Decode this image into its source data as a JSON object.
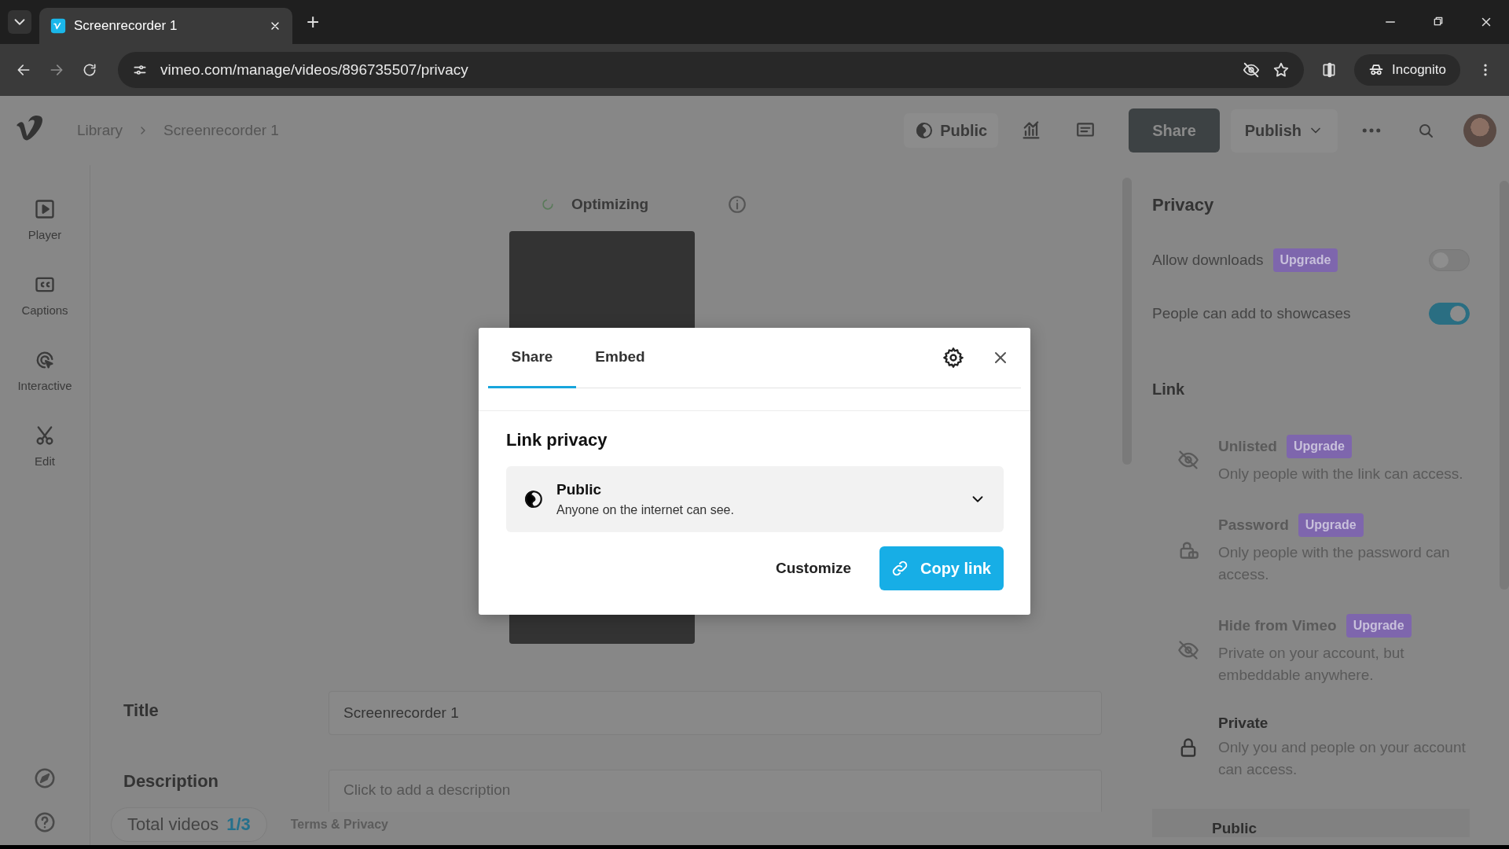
{
  "browser": {
    "tabs": [
      {
        "title": "Screenrecorder 1",
        "selected": true
      }
    ],
    "new_tab": "+",
    "address": "vimeo.com/manage/videos/896735507/privacy",
    "profile": "Incognito"
  },
  "header": {
    "breadcrumb": [
      "Library",
      "Screenrecorder 1"
    ],
    "privacy": "Public",
    "share": "Share",
    "publish": "Publish"
  },
  "sidebar": {
    "items": [
      {
        "label": "Player"
      },
      {
        "label": "Captions"
      },
      {
        "label": "Interactive"
      },
      {
        "label": "Edit"
      }
    ]
  },
  "main": {
    "status": "Optimizing",
    "fields": [
      {
        "label": "Title",
        "value": "Screenrecorder 1"
      },
      {
        "label": "Description",
        "placeholder": "Click to add a description"
      }
    ],
    "total_label": "Total videos",
    "total_count": "1/3",
    "terms": "Terms & Privacy"
  },
  "privacy_panel": {
    "title": "Privacy",
    "settings": [
      {
        "label": "Allow downloads",
        "badge": "Upgrade",
        "on": false
      },
      {
        "label": "People can add to showcases",
        "on": true
      }
    ],
    "link_heading": "Link",
    "options": [
      {
        "title": "Unlisted",
        "badge": "Upgrade",
        "description": "Only people with the link can access.",
        "disabled": true
      },
      {
        "title": "Password",
        "badge": "Upgrade",
        "description": "Only people with the password can access.",
        "disabled": true
      },
      {
        "title": "Hide from Vimeo",
        "badge": "Upgrade",
        "description": "Private on your account, but embeddable anywhere.",
        "disabled": true
      },
      {
        "title": "Private",
        "description": "Only you and people on your account can access.",
        "disabled": false
      },
      {
        "title": "Public",
        "disabled": false
      }
    ]
  },
  "modal": {
    "tabs": [
      {
        "label": "Share",
        "selected": true
      },
      {
        "label": "Embed",
        "selected": false
      }
    ],
    "heading": "Link privacy",
    "dropdown": {
      "title": "Public",
      "description": "Anyone on the internet can see."
    },
    "customize": "Customize",
    "copy": "Copy link"
  }
}
